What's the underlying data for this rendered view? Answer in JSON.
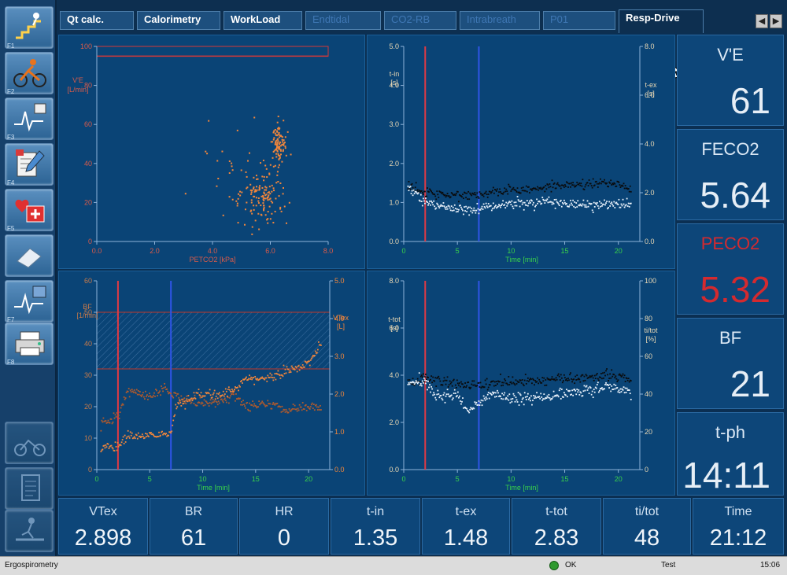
{
  "tabs": [
    {
      "label": "Qt calc.",
      "state": "normal"
    },
    {
      "label": "Calorimetry",
      "state": "normal"
    },
    {
      "label": "WorkLoad",
      "state": "normal"
    },
    {
      "label": "Endtidal",
      "state": "disabled"
    },
    {
      "label": "CO2-RB",
      "state": "disabled"
    },
    {
      "label": "Intrabreath",
      "state": "disabled"
    },
    {
      "label": "P01",
      "state": "disabled"
    },
    {
      "label": "Resp-Drive",
      "state": "active"
    }
  ],
  "nav": {
    "prev": "◀",
    "next": "▶"
  },
  "toolbar": [
    {
      "key": "F1",
      "icon": "stairs-icon"
    },
    {
      "key": "F2",
      "icon": "cyclist-icon"
    },
    {
      "key": "F3",
      "icon": "ecg-save-icon"
    },
    {
      "key": "F4",
      "icon": "clipboard-edit-icon"
    },
    {
      "key": "F5",
      "icon": "heart-medical-icon"
    },
    {
      "key": "",
      "icon": "eraser-icon"
    },
    {
      "key": "F7",
      "icon": "ecg-disk-icon"
    },
    {
      "key": "F8",
      "icon": "printer-icon"
    },
    {
      "key": "",
      "icon": "bike-test-icon"
    },
    {
      "key": "",
      "icon": "protocol-list-icon"
    },
    {
      "key": "",
      "icon": "treadmill-icon"
    }
  ],
  "colors": {
    "orange": "#f2863b",
    "white": "#eaf2fb",
    "black": "#0a0a0a",
    "red": "#e03a44",
    "blue": "#2f55e6",
    "brown": "#b05a2c",
    "alert": "#d42a2f"
  },
  "right_values": [
    {
      "label": "V'E",
      "value": "61",
      "alert": false
    },
    {
      "label": "FECO2",
      "value": "5.64",
      "alert": false
    },
    {
      "label": "PECO2",
      "value": "5.32",
      "alert": true
    },
    {
      "label": "BF",
      "value": "21",
      "alert": false
    },
    {
      "label": "t-ph",
      "value": "14:11",
      "alert": false
    }
  ],
  "bottom_values": [
    {
      "label": "VTex",
      "value": "2.898"
    },
    {
      "label": "BR",
      "value": "61"
    },
    {
      "label": "HR",
      "value": "0"
    },
    {
      "label": "t-in",
      "value": "1.35"
    },
    {
      "label": "t-ex",
      "value": "1.48"
    },
    {
      "label": "t-tot",
      "value": "2.83"
    },
    {
      "label": "ti/tot",
      "value": "48"
    },
    {
      "label": "Time",
      "value": "21:12"
    }
  ],
  "status": {
    "app": "Ergospirometry",
    "ok": "OK",
    "mode": "Test",
    "clock": "15:06"
  },
  "chart_data": [
    {
      "type": "scatter",
      "xlabel": "PETCO2 [kPa]",
      "ylabel": "V'E [L/min]",
      "xlim": [
        0,
        8
      ],
      "ylim": [
        0,
        100
      ],
      "xticks": [
        "0.0",
        "2.0",
        "4.0",
        "6.0",
        "8.0"
      ],
      "yticks": [
        "0",
        "20",
        "40",
        "60",
        "80",
        "100"
      ],
      "threshold_y": 95,
      "clusters": [
        {
          "name": "",
          "cx": 5.7,
          "cy": 22,
          "sx": 0.35,
          "sy": 7,
          "n": 120
        },
        {
          "name": "",
          "cx": 6.3,
          "cy": 50,
          "sx": 0.12,
          "sy": 5,
          "n": 90
        },
        {
          "name": "",
          "cx": 5.2,
          "cy": 32,
          "sx": 1.0,
          "sy": 14,
          "n": 40
        }
      ]
    },
    {
      "type": "scatter",
      "xlabel": "Time [min]",
      "ylabel_left": "t-in [s]",
      "ylabel_right": "t-ex [s]",
      "xlim": [
        0,
        22
      ],
      "ylim_left": [
        0,
        5
      ],
      "ylim_right": [
        0,
        8
      ],
      "xticks": [
        "0",
        "5",
        "10",
        "15",
        "20"
      ],
      "yticks_left": [
        "0.0",
        "1.0",
        "2.0",
        "3.0",
        "4.0",
        "5.0"
      ],
      "yticks_right": [
        "0.0",
        "2.0",
        "4.0",
        "6.0",
        "8.0"
      ],
      "markers": [
        {
          "x": 2.0,
          "color": "red"
        },
        {
          "x": 7.0,
          "color": "blue"
        }
      ],
      "series": [
        {
          "name": "",
          "axis": "right",
          "color": "black",
          "points": [
            [
              0.5,
              2.3
            ],
            [
              2,
              2.0
            ],
            [
              5,
              1.9
            ],
            [
              8,
              2.0
            ],
            [
              10,
              2.1
            ],
            [
              13,
              2.2
            ],
            [
              16,
              2.3
            ],
            [
              19,
              2.4
            ],
            [
              21,
              2.2
            ]
          ]
        },
        {
          "name": "",
          "axis": "left",
          "color": "white",
          "points": [
            [
              0.5,
              1.4
            ],
            [
              2,
              1.0
            ],
            [
              5,
              0.85
            ],
            [
              6,
              0.8
            ],
            [
              8,
              0.9
            ],
            [
              10,
              0.95
            ],
            [
              13,
              1.0
            ],
            [
              16,
              0.95
            ],
            [
              21,
              0.95
            ]
          ]
        }
      ]
    },
    {
      "type": "line",
      "xlabel": "Time [min]",
      "ylabel_left": "BF [1/min]",
      "ylabel_right": "VTex [L]",
      "xlim": [
        0,
        22
      ],
      "ylim_left": [
        0,
        60
      ],
      "ylim_right": [
        0,
        5
      ],
      "xticks": [
        "0",
        "5",
        "10",
        "15",
        "20"
      ],
      "yticks_left": [
        "0",
        "10",
        "20",
        "30",
        "40",
        "50",
        "60"
      ],
      "yticks_right": [
        "0.0",
        "1.0",
        "2.0",
        "3.0",
        "4.0",
        "5.0"
      ],
      "markers": [
        {
          "x": 2.0,
          "color": "red"
        },
        {
          "x": 7.0,
          "color": "blue"
        }
      ],
      "reference_band": [
        32,
        50
      ],
      "series": [
        {
          "name": "",
          "axis": "left",
          "color": "brown",
          "points": [
            [
              0.5,
              15
            ],
            [
              2,
              17
            ],
            [
              3,
              25
            ],
            [
              5,
              23
            ],
            [
              6.5,
              26
            ],
            [
              7,
              24
            ],
            [
              8,
              22
            ],
            [
              10,
              21
            ],
            [
              12,
              22
            ],
            [
              13,
              24
            ],
            [
              14,
              20
            ],
            [
              16,
              21
            ],
            [
              18,
              19
            ],
            [
              20,
              20
            ],
            [
              21,
              20
            ]
          ]
        },
        {
          "name": "",
          "axis": "right",
          "color": "orange",
          "points": [
            [
              0.5,
              0.6
            ],
            [
              2,
              0.6
            ],
            [
              3,
              0.9
            ],
            [
              5,
              0.9
            ],
            [
              7,
              0.95
            ],
            [
              7.5,
              1.7
            ],
            [
              9,
              1.9
            ],
            [
              11,
              2.0
            ],
            [
              13,
              2.1
            ],
            [
              14,
              2.4
            ],
            [
              16,
              2.4
            ],
            [
              18,
              2.6
            ],
            [
              20,
              2.8
            ],
            [
              21,
              3.3
            ]
          ]
        }
      ]
    },
    {
      "type": "scatter",
      "xlabel": "Time [min]",
      "ylabel_left": "t-tot [s]",
      "ylabel_right": "ti/tot [%]",
      "xlim": [
        0,
        22
      ],
      "ylim_left": [
        0,
        8
      ],
      "ylim_right": [
        0,
        100
      ],
      "xticks": [
        "0",
        "5",
        "10",
        "15",
        "20"
      ],
      "yticks_left": [
        "0.0",
        "2.0",
        "4.0",
        "6.0",
        "8.0"
      ],
      "yticks_right": [
        "0",
        "20",
        "40",
        "60",
        "80",
        "100"
      ],
      "markers": [
        {
          "x": 2.0,
          "color": "red"
        },
        {
          "x": 7.0,
          "color": "blue"
        }
      ],
      "series": [
        {
          "name": "",
          "axis": "left",
          "color": "black",
          "points": [
            [
              0.5,
              3.7
            ],
            [
              2,
              3.9
            ],
            [
              5,
              3.6
            ],
            [
              8,
              3.6
            ],
            [
              10,
              3.7
            ],
            [
              13,
              3.8
            ],
            [
              16,
              3.9
            ],
            [
              19,
              4.0
            ],
            [
              21,
              3.8
            ]
          ]
        },
        {
          "name": "",
          "axis": "right",
          "color": "white",
          "points": [
            [
              0.5,
              46
            ],
            [
              2,
              47
            ],
            [
              3,
              38
            ],
            [
              5,
              40
            ],
            [
              6,
              30
            ],
            [
              8,
              40
            ],
            [
              10,
              37
            ],
            [
              13,
              38
            ],
            [
              16,
              41
            ],
            [
              19,
              44
            ],
            [
              21,
              41
            ]
          ]
        }
      ]
    }
  ]
}
